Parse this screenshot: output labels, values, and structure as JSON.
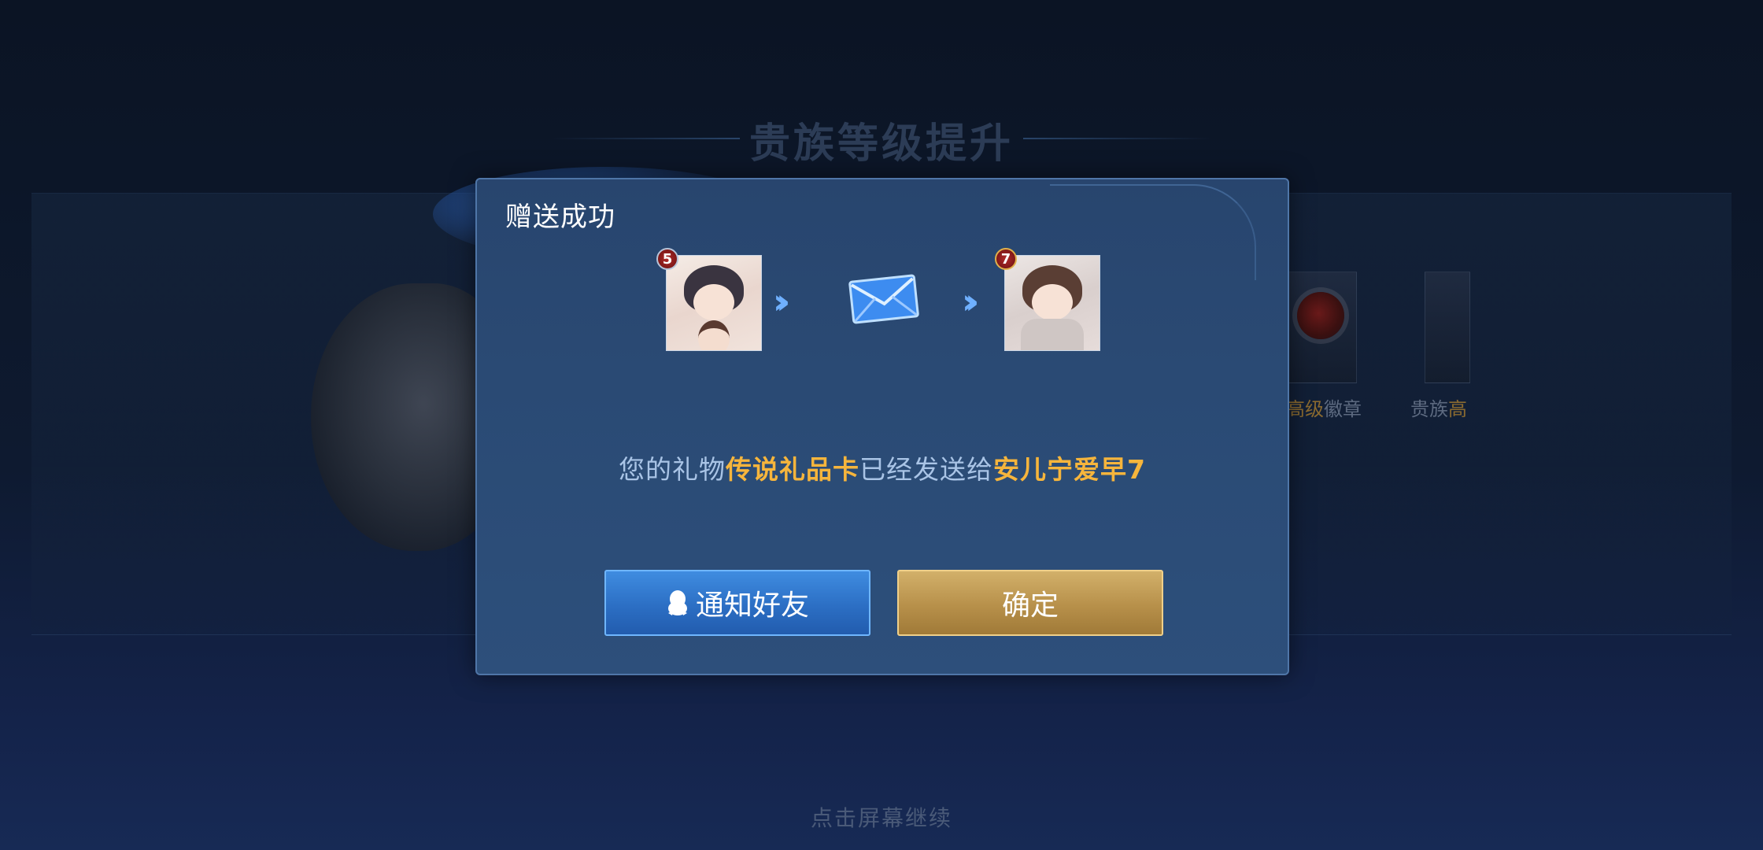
{
  "background": {
    "title": "贵族等级提升",
    "labels": [
      {
        "prefix": "",
        "highlight": "高级",
        "suffix": "徽章"
      },
      {
        "prefix": "贵族",
        "highlight": "高",
        "suffix": ""
      }
    ],
    "continue_hint": "点击屏幕继续"
  },
  "dialog": {
    "title": "赠送成功",
    "sender_rank": "5",
    "receiver_rank": "7",
    "message": {
      "part1": "您的礼物",
      "gift_name": "传说礼品卡",
      "part2": "已经发送给",
      "recipient": "安儿宁爱早7"
    },
    "buttons": {
      "notify_label": "通知好友",
      "confirm_label": "确定"
    }
  },
  "colors": {
    "highlight": "#f6b53c",
    "notify_button": "#2c6fc4",
    "confirm_button": "#b7904a"
  }
}
